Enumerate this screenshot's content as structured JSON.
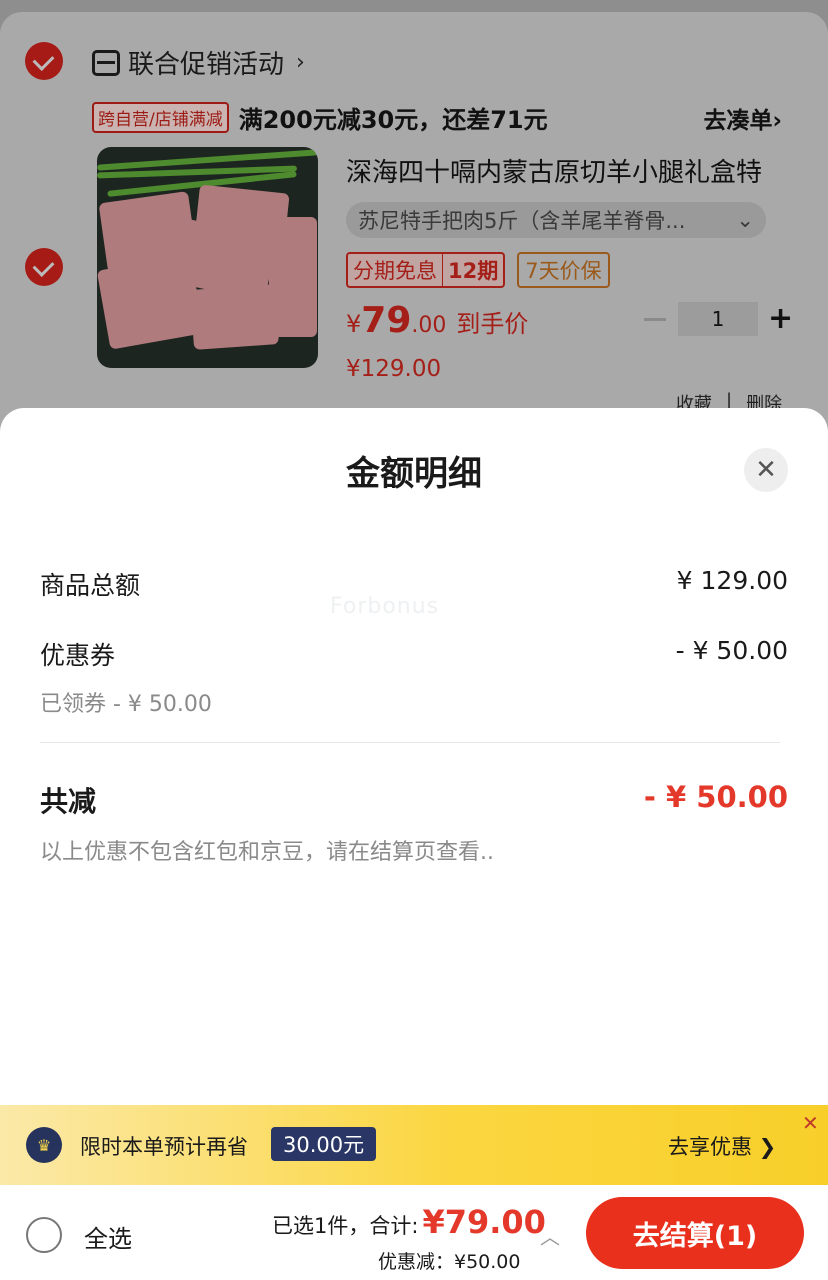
{
  "cart": {
    "shop_name": "联合促销活动",
    "promo_tag": "跨自营/店铺满减",
    "promo_text": "满200元减30元，还差71元",
    "promo_link": "去凑单",
    "product_title": "深海四十嗝内蒙古原切羊小腿礼盒特",
    "sku": "苏尼特手把肉5斤（含羊尾羊脊骨...",
    "tag_installment": "分期免息",
    "tag_installment_period": "12期",
    "tag_price_protect": "7天价保",
    "price_currency": "¥",
    "price_int": "79",
    "price_dec": ".00",
    "price_label": "到手价",
    "original_price": "¥129.00",
    "quantity": "1",
    "fav_label": "收藏",
    "sep": "|",
    "delete_label": "删除"
  },
  "sheet": {
    "title": "金额明细",
    "close_icon": "close-icon",
    "watermark": "Forbonus",
    "goods_total_label": "商品总额",
    "goods_total_value": "¥ 129.00",
    "coupon_label": "优惠券",
    "coupon_value": "- ¥ 50.00",
    "coupon_note": "已领券 - ¥ 50.00",
    "total_off_label": "共减",
    "total_off_value": "- ¥ 50.00",
    "footnote": "以上优惠不包含红包和京豆，请在结算页查看.."
  },
  "promo_bar": {
    "text": "限时本单预计再省",
    "badge": "30.00元",
    "link": "去享优惠 ❯",
    "close": "✕"
  },
  "bottom": {
    "select_all": "全选",
    "selected_label": "已选1件，合计:",
    "total_amount": "¥79.00",
    "discount_line": "优惠减：¥50.00",
    "checkout": "去结算(1)"
  },
  "colors": {
    "accent_red": "#e4392a",
    "checkout_red": "#e8301d",
    "badge_navy": "#2a3766",
    "promo_yellow": "#fbd63f"
  }
}
